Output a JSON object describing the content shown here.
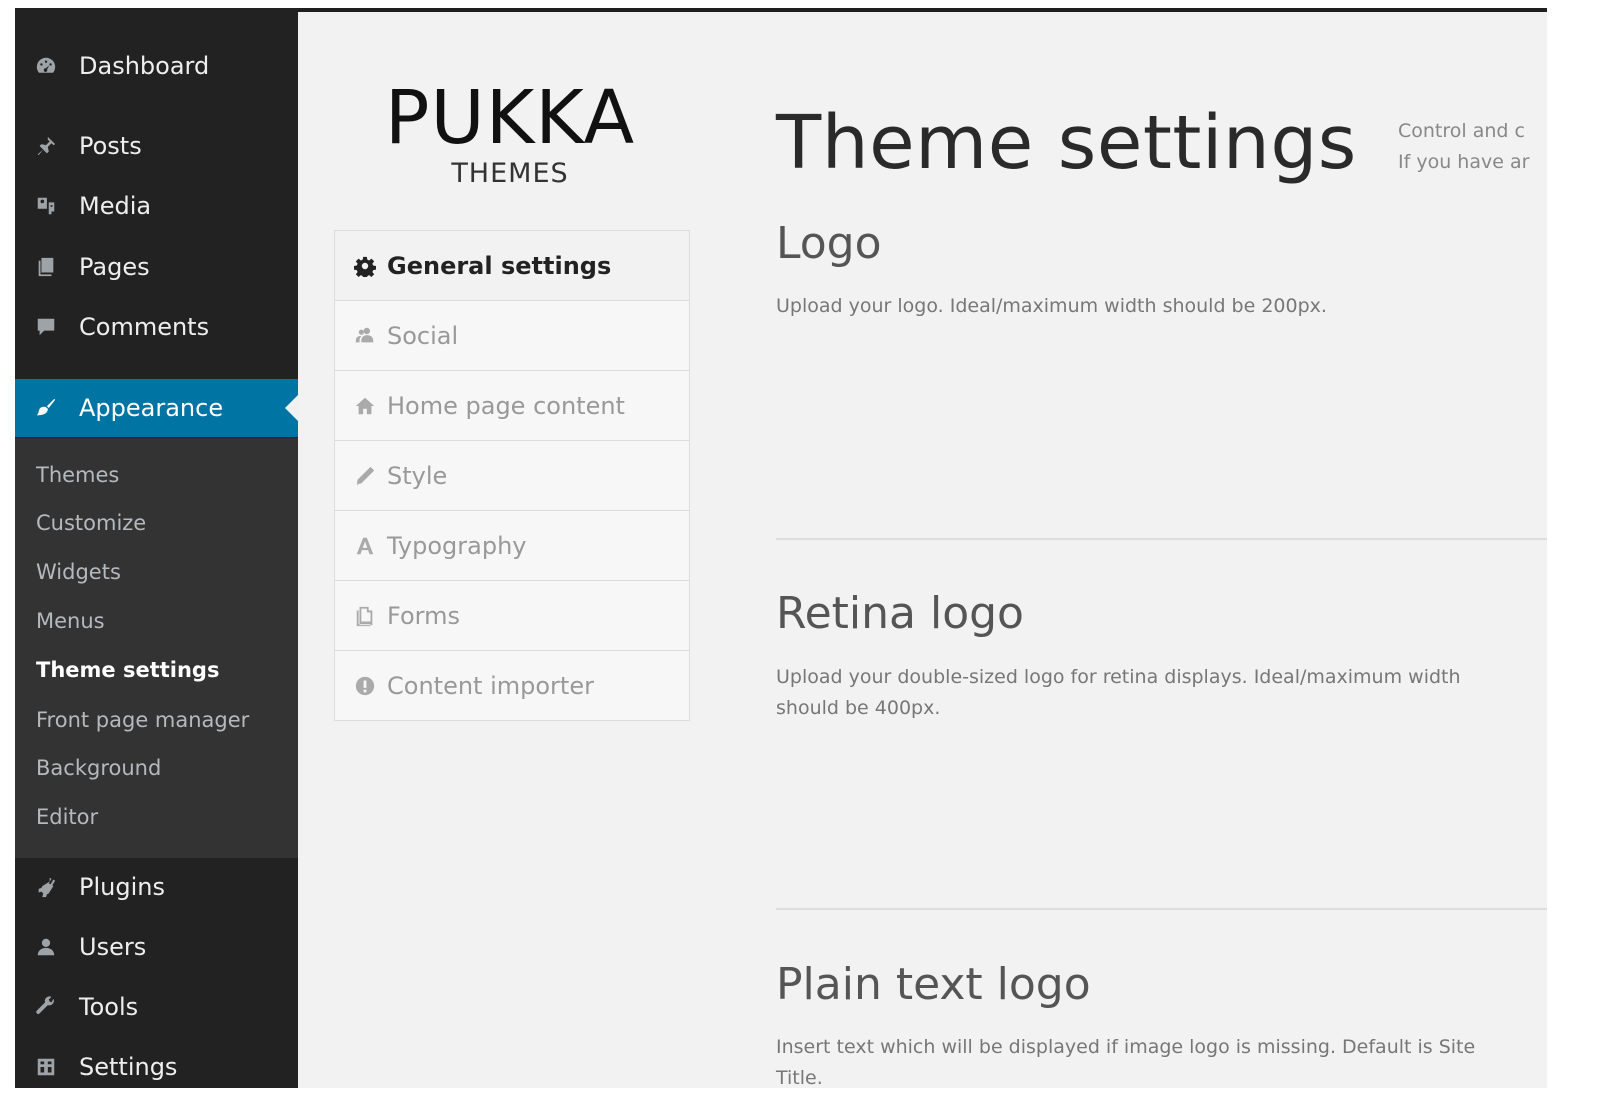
{
  "sidebar": {
    "menu": [
      {
        "label": "Dashboard",
        "icon": "dashboard-icon"
      },
      {
        "label": "Posts",
        "icon": "pin-icon"
      },
      {
        "label": "Media",
        "icon": "media-icon"
      },
      {
        "label": "Pages",
        "icon": "pages-icon"
      },
      {
        "label": "Comments",
        "icon": "comment-icon"
      },
      {
        "label": "Appearance",
        "icon": "paintbrush-icon",
        "active": true
      },
      {
        "label": "Plugins",
        "icon": "plug-icon"
      },
      {
        "label": "Users",
        "icon": "user-icon"
      },
      {
        "label": "Tools",
        "icon": "wrench-icon"
      },
      {
        "label": "Settings",
        "icon": "settings-icon"
      }
    ],
    "submenu": [
      "Themes",
      "Customize",
      "Widgets",
      "Menus",
      "Theme settings",
      "Front page manager",
      "Background",
      "Editor"
    ],
    "submenu_current": "Theme settings",
    "active_color": "#0074a2"
  },
  "brand": {
    "name": "PUKKA",
    "sub": "THEMES"
  },
  "tabs": [
    {
      "label": "General settings",
      "icon": "gear-icon",
      "active": true
    },
    {
      "label": "Social",
      "icon": "social-icon"
    },
    {
      "label": "Home page content",
      "icon": "home-icon"
    },
    {
      "label": "Style",
      "icon": "pencil-icon"
    },
    {
      "label": "Typography",
      "icon": "typography-icon"
    },
    {
      "label": "Forms",
      "icon": "forms-icon"
    },
    {
      "label": "Content importer",
      "icon": "importer-icon"
    }
  ],
  "header": {
    "title": "Theme settings",
    "desc_line1": "Control and c",
    "desc_line2": "If you have ar"
  },
  "sections": [
    {
      "title": "Logo",
      "desc": "Upload your logo. Ideal/maximum width should be 200px."
    },
    {
      "title": "Retina logo",
      "desc": "Upload your double-sized logo for retina displays. Ideal/maximum width should be 400px."
    },
    {
      "title": "Plain text logo",
      "desc": "Insert text which will be displayed if image logo is missing. Default is Site Title."
    }
  ]
}
